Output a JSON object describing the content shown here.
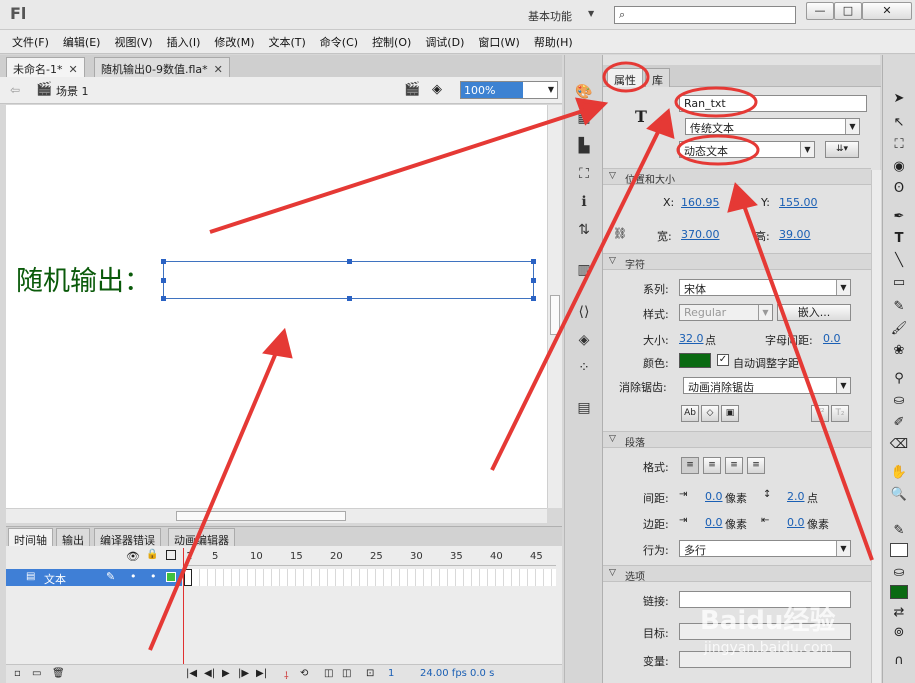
{
  "app": {
    "logo": "Fl",
    "workspace": "基本功能"
  },
  "menu": [
    "文件(F)",
    "编辑(E)",
    "视图(V)",
    "插入(I)",
    "修改(M)",
    "文本(T)",
    "命令(C)",
    "控制(O)",
    "调试(D)",
    "窗口(W)",
    "帮助(H)"
  ],
  "doc_tabs": [
    {
      "label": "未命名-1*",
      "active": true
    },
    {
      "label": "随机输出0-9数值.fla*",
      "active": false
    }
  ],
  "scene": {
    "label": "场景 1",
    "zoom": "100%"
  },
  "stage": {
    "text_label": "随机输出：",
    "text_color": "#0a5a0a"
  },
  "timeline": {
    "tabs": [
      "时间轴",
      "输出",
      "编译器错误",
      "动画编辑器"
    ],
    "ruler": [
      "1",
      "5",
      "10",
      "15",
      "20",
      "25",
      "30",
      "35",
      "40",
      "45"
    ],
    "layer_name": "文本",
    "current_frame": "1",
    "fps": "24.00 fps",
    "time": "0.0 s"
  },
  "properties": {
    "tabs": [
      "属性",
      "库"
    ],
    "instance_name": "Ran_txt",
    "text_engine": "传统文本",
    "text_type": "动态文本",
    "position_section": "位置和大小",
    "x_label": "X:",
    "x": "160.95",
    "y_label": "Y:",
    "y": "155.00",
    "w_label": "宽:",
    "w": "370.00",
    "h_label": "高:",
    "h": "39.00",
    "char_section": "字符",
    "family_label": "系列:",
    "family": "宋体",
    "style_label": "样式:",
    "style": "Regular",
    "embed": "嵌入...",
    "size_label": "大小:",
    "size": "32.0",
    "size_unit": "点",
    "spacing_label": "字母间距:",
    "spacing": "0.0",
    "color_label": "颜色:",
    "color": "#0a6a12",
    "autokern": "自动调整字距",
    "antialias_label": "消除锯齿:",
    "antialias": "动画消除锯齿",
    "para_section": "段落",
    "format_label": "格式:",
    "gap_label": "间距:",
    "indent": "0.0",
    "indent_unit": "像素",
    "line_spacing": "2.0",
    "line_unit": "点",
    "margin_label": "边距:",
    "margin_left": "0.0",
    "margin_left_unit": "像素",
    "margin_right": "0.0",
    "margin_right_unit": "像素",
    "behavior_label": "行为:",
    "behavior": "多行",
    "options_section": "选项",
    "link_label": "链接:",
    "target_label": "目标:",
    "variable_label": "变量:"
  },
  "watermark": {
    "brand": "Baidu经验",
    "url": "jingyan.baidu.com"
  },
  "annotation_color": "#e53935"
}
